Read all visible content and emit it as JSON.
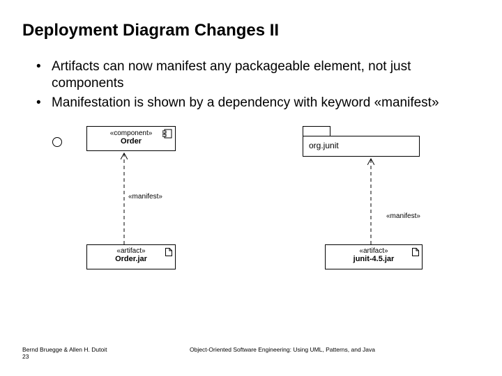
{
  "title": "Deployment Diagram Changes II",
  "bullets": [
    "Artifacts can now manifest any packageable element, not just components",
    "Manifestation is shown by a dependency with keyword «manifest»"
  ],
  "diagram": {
    "left_component": {
      "stereotype": "«component»",
      "name": "Order"
    },
    "left_artifact": {
      "stereotype": "«artifact»",
      "name": "Order.jar"
    },
    "left_manifest": "«manifest»",
    "right_package": "org.junit",
    "right_artifact": {
      "stereotype": "«artifact»",
      "name": "junit-4.5.jar"
    },
    "right_manifest": "«manifest»"
  },
  "footer": {
    "authors": "Bernd Bruegge & Allen H. Dutoit",
    "page": "23",
    "book": "Object-Oriented Software Engineering: Using UML, Patterns, and Java"
  }
}
